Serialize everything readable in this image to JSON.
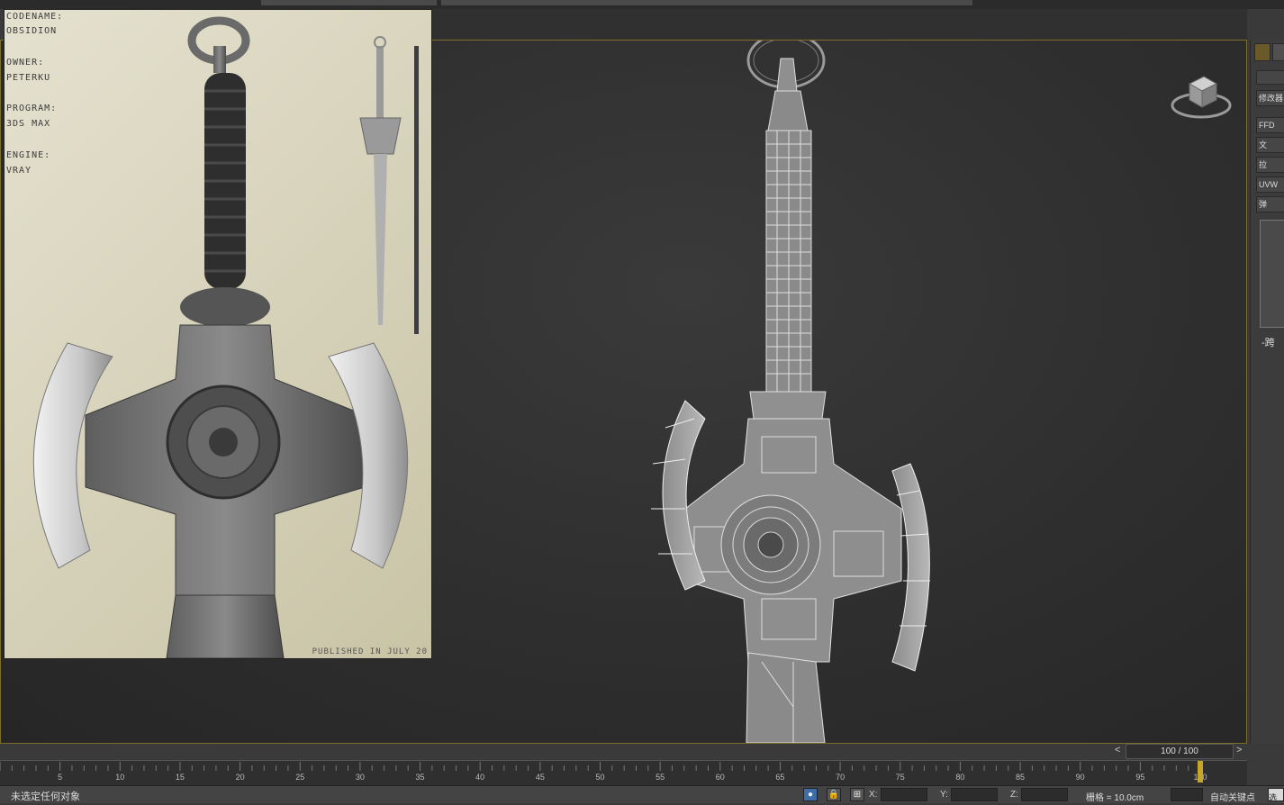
{
  "reference_image": {
    "codename_label": "CODENAME:",
    "codename_value": "OBSIDION",
    "owner_label": "OWNER:",
    "owner_value": "PETERKU",
    "program_label": "PROGRAM:",
    "program_value": "3DS MAX",
    "engine_label": "ENGINE:",
    "engine_value": "VRAY",
    "footer": "PUBLISHED IN JULY 20"
  },
  "command_panel": {
    "modifier_list": "修改器",
    "ffd": "FFD",
    "btn_a": "文",
    "btn_b": "拉",
    "uvw": "UVW",
    "btn_c": "弹",
    "small_label": "-跨"
  },
  "time_slider": {
    "frame_display": "100 / 100",
    "prev_arrow": "<",
    "next_arrow": ">"
  },
  "trackbar": {
    "labels": [
      "5",
      "10",
      "15",
      "20",
      "25",
      "30",
      "35",
      "40",
      "45",
      "50",
      "55",
      "60",
      "65",
      "70",
      "75",
      "80",
      "85",
      "90",
      "95",
      "100"
    ]
  },
  "status_bar": {
    "prompt": "未选定任何对象",
    "x_label": "X:",
    "y_label": "Y:",
    "z_label": "Z:",
    "grid": "栅格 = 10.0cm",
    "auto_key": "自动关键点",
    "selected_short": "选"
  },
  "colors": {
    "accent": "#c6a528",
    "viewport_border": "#7d6d2a",
    "wire": "#d8d8d8"
  }
}
